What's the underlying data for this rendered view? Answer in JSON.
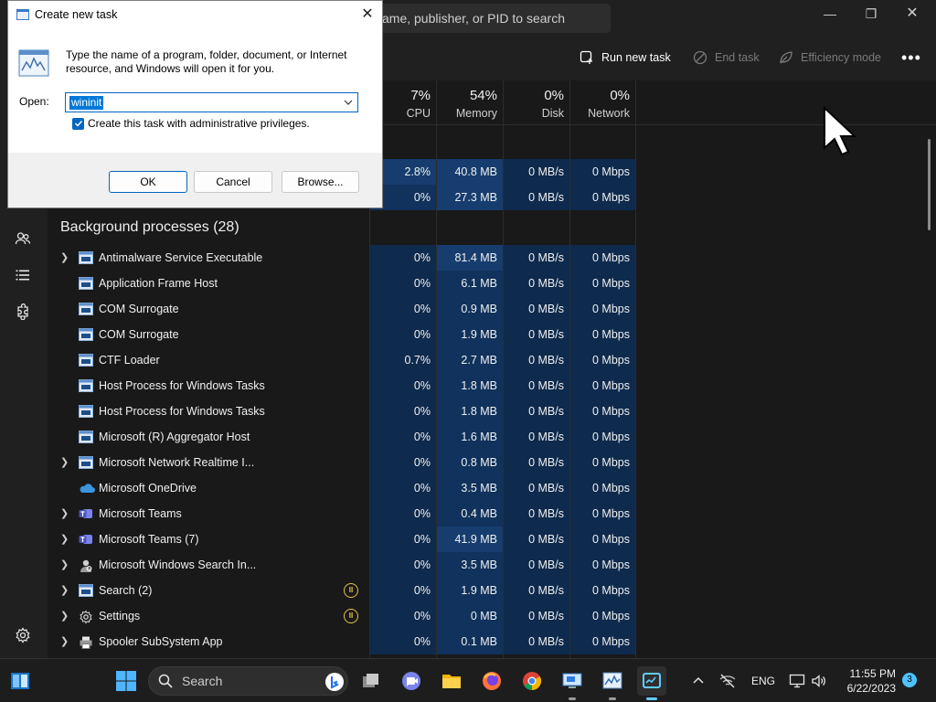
{
  "task_manager": {
    "search_placeholder": "ame, publisher, or PID to search",
    "window_controls": {
      "minimize": "—",
      "maximize": "❐",
      "close": "✕"
    },
    "toolbar": {
      "run_new_task": "Run new task",
      "end_task": "End task",
      "efficiency_mode": "Efficiency mode",
      "more": "•••"
    },
    "columns": [
      {
        "pct": "7%",
        "label": "CPU"
      },
      {
        "pct": "54%",
        "label": "Memory"
      },
      {
        "pct": "0%",
        "label": "Disk"
      },
      {
        "pct": "0%",
        "label": "Network"
      }
    ],
    "app_rows": [
      {
        "cpu": "2.8%",
        "memory": "40.8 MB",
        "disk": "0 MB/s",
        "network": "0 Mbps"
      },
      {
        "cpu": "0%",
        "memory": "27.3 MB",
        "disk": "0 MB/s",
        "network": "0 Mbps"
      }
    ],
    "background_heading": "Background processes (28)",
    "processes": [
      {
        "name": "Antimalware Service Executable",
        "expand": true,
        "icon": "window-icon",
        "status": "",
        "cpu": "0%",
        "memory": "81.4 MB",
        "disk": "0 MB/s",
        "network": "0 Mbps"
      },
      {
        "name": "Application Frame Host",
        "expand": false,
        "icon": "window-icon",
        "status": "",
        "cpu": "0%",
        "memory": "6.1 MB",
        "disk": "0 MB/s",
        "network": "0 Mbps"
      },
      {
        "name": "COM Surrogate",
        "expand": false,
        "icon": "window-icon",
        "status": "",
        "cpu": "0%",
        "memory": "0.9 MB",
        "disk": "0 MB/s",
        "network": "0 Mbps"
      },
      {
        "name": "COM Surrogate",
        "expand": false,
        "icon": "window-icon",
        "status": "",
        "cpu": "0%",
        "memory": "1.9 MB",
        "disk": "0 MB/s",
        "network": "0 Mbps"
      },
      {
        "name": "CTF Loader",
        "expand": false,
        "icon": "window-icon",
        "status": "",
        "cpu": "0.7%",
        "memory": "2.7 MB",
        "disk": "0 MB/s",
        "network": "0 Mbps"
      },
      {
        "name": "Host Process for Windows Tasks",
        "expand": false,
        "icon": "window-icon",
        "status": "",
        "cpu": "0%",
        "memory": "1.8 MB",
        "disk": "0 MB/s",
        "network": "0 Mbps"
      },
      {
        "name": "Host Process for Windows Tasks",
        "expand": false,
        "icon": "window-icon",
        "status": "",
        "cpu": "0%",
        "memory": "1.8 MB",
        "disk": "0 MB/s",
        "network": "0 Mbps"
      },
      {
        "name": "Microsoft (R) Aggregator Host",
        "expand": false,
        "icon": "window-icon",
        "status": "",
        "cpu": "0%",
        "memory": "1.6 MB",
        "disk": "0 MB/s",
        "network": "0 Mbps"
      },
      {
        "name": "Microsoft Network Realtime I...",
        "expand": true,
        "icon": "window-icon",
        "status": "",
        "cpu": "0%",
        "memory": "0.8 MB",
        "disk": "0 MB/s",
        "network": "0 Mbps"
      },
      {
        "name": "Microsoft OneDrive",
        "expand": false,
        "icon": "onedrive-icon",
        "status": "",
        "cpu": "0%",
        "memory": "3.5 MB",
        "disk": "0 MB/s",
        "network": "0 Mbps"
      },
      {
        "name": "Microsoft Teams",
        "expand": true,
        "icon": "teams-icon",
        "status": "",
        "cpu": "0%",
        "memory": "0.4 MB",
        "disk": "0 MB/s",
        "network": "0 Mbps"
      },
      {
        "name": "Microsoft Teams (7)",
        "expand": true,
        "icon": "teams-icon",
        "status": "",
        "cpu": "0%",
        "memory": "41.9 MB",
        "disk": "0 MB/s",
        "network": "0 Mbps"
      },
      {
        "name": "Microsoft Windows Search In...",
        "expand": true,
        "icon": "search-indexer-icon",
        "status": "",
        "cpu": "0%",
        "memory": "3.5 MB",
        "disk": "0 MB/s",
        "network": "0 Mbps"
      },
      {
        "name": "Search (2)",
        "expand": true,
        "icon": "window-icon",
        "status": "paused",
        "cpu": "0%",
        "memory": "1.9 MB",
        "disk": "0 MB/s",
        "network": "0 Mbps"
      },
      {
        "name": "Settings",
        "expand": true,
        "icon": "gear-icon",
        "status": "paused",
        "cpu": "0%",
        "memory": "0 MB",
        "disk": "0 MB/s",
        "network": "0 Mbps"
      },
      {
        "name": "Spooler SubSystem App",
        "expand": true,
        "icon": "printer-icon",
        "status": "",
        "cpu": "0%",
        "memory": "0.1 MB",
        "disk": "0 MB/s",
        "network": "0 Mbps"
      }
    ]
  },
  "run_dialog": {
    "title": "Create new task",
    "close": "✕",
    "description": "Type the name of a program, folder, document, or Internet resource, and Windows will open it for you.",
    "open_label": "Open:",
    "input_value": "wininit",
    "admin_label": "Create this task with administrative privileges.",
    "admin_checked": true,
    "ok": "OK",
    "cancel": "Cancel",
    "browse": "Browse..."
  },
  "taskbar": {
    "search_label": "Search",
    "language": "ENG",
    "time": "11:55 PM",
    "date": "6/22/2023",
    "notifications": "3",
    "accent": "#60cdff"
  },
  "colors": {
    "heat_high": "#163d6e",
    "heat_mid": "#10325c",
    "heat_low": "#0e2a4d",
    "dialog_accent": "#0067c0"
  }
}
